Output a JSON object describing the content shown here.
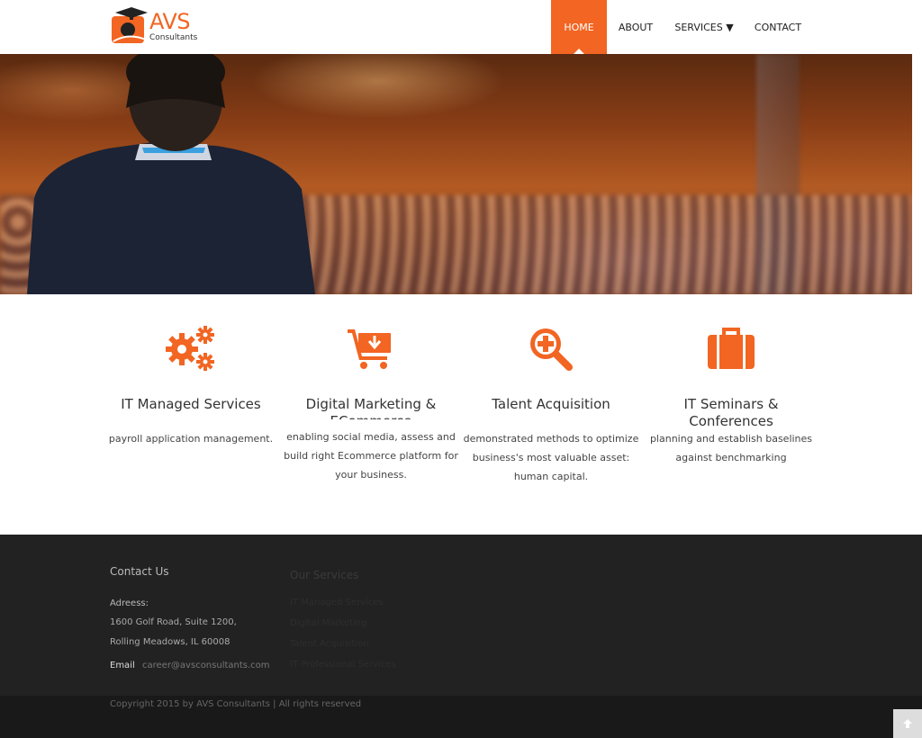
{
  "brand": {
    "name": "AVS",
    "tagline": "Consultants",
    "accent": "#f26522"
  },
  "nav": {
    "home": "HOME",
    "about": "ABOUT",
    "services": "SERVICES ▼",
    "contact": "CONTACT"
  },
  "services": [
    {
      "icon": "gears-icon",
      "title": "IT Managed Services",
      "desc_cut": "payroll application management.",
      "desc": []
    },
    {
      "icon": "cart-icon",
      "title": "Digital Marketing & ECommerce",
      "desc": [
        "enabling social media, assess and",
        "build right Ecommerce platform for",
        "your business."
      ]
    },
    {
      "icon": "magnifier-plus-icon",
      "title": "Talent Acquisition",
      "desc": [
        "demonstrated methods to optimize",
        "business's most valuable asset:",
        "human capital."
      ]
    },
    {
      "icon": "briefcase-icon",
      "title": "IT Seminars & Conferences",
      "desc": [
        "planning and establish baselines",
        "against benchmarking"
      ]
    }
  ],
  "footer": {
    "contact_heading": "Contact Us",
    "address_label": "Adreess:",
    "address_line1": "1600 Golf Road, Suite 1200,",
    "address_line2": "Rolling Meadows, IL 60008",
    "email_label": "Email",
    "email_value": "career@avsconsultants.com",
    "services_heading": "Our Services",
    "service_links": [
      "IT Managed Services",
      "Digital Marketing",
      "Talent Acquisition",
      "IT Professional Services"
    ],
    "copyright": "Copyright 2015 by AVS Consultants | All rights reserved"
  }
}
